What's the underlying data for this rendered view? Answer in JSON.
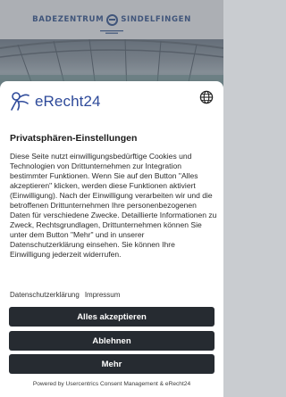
{
  "site": {
    "logo_left": "BADEZENTRUM",
    "logo_right": "SINDELFINGEN"
  },
  "dialog": {
    "brand": "eRecht24",
    "title": "Privatsphären-Einstellungen",
    "body": "Diese Seite nutzt einwilligungsbedürftige Cookies und Technologien von Drittunternehmen zur Integration bestimmter Funktionen. Wenn Sie auf den Button \"Alles akzeptieren\" klicken, werden diese Funktionen aktiviert (Einwilligung). Nach der Einwilligung verarbeiten wir und die betroffenen Drittunternehmen Ihre personenbezogenen Daten für verschiedene Zwecke. Detaillierte Informationen zu Zweck, Rechtsgrundlagen, Drittunternehmen können Sie unter dem Button \"Mehr\" und in unserer Datenschutzerklärung einsehen. Sie können Ihre Einwilligung jederzeit widerrufen.",
    "links": {
      "privacy": "Datenschutzerklärung",
      "imprint": "Impressum"
    },
    "buttons": {
      "accept": "Alles akzeptieren",
      "deny": "Ablehnen",
      "more": "Mehr"
    },
    "powered_by": "Powered by Usercentrics Consent Management & eRecht24"
  },
  "colors": {
    "brand_blue": "#2e4a9a",
    "button_dark": "#262b31",
    "site_blue": "#2d4f8a"
  },
  "icons": {
    "globe": "globe-icon",
    "brand_mark": "erecht24-logo-icon",
    "hamburger": "menu-icon"
  }
}
